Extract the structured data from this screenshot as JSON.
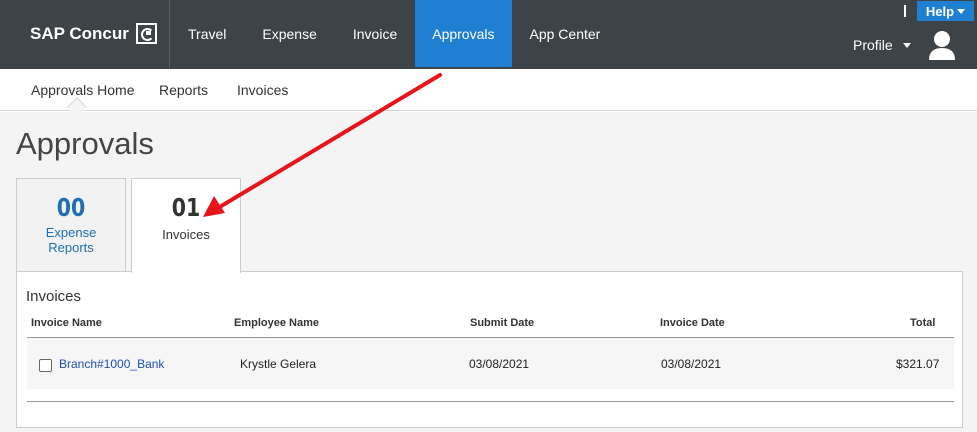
{
  "brand": {
    "name": "SAP Concur"
  },
  "nav": {
    "items": [
      {
        "label": "Travel"
      },
      {
        "label": "Expense"
      },
      {
        "label": "Invoice"
      },
      {
        "label": "Approvals"
      },
      {
        "label": "App Center"
      }
    ],
    "active_color": "#1f7fd1"
  },
  "header": {
    "help_label": "Help",
    "profile_label": "Profile"
  },
  "subnav": {
    "items": [
      {
        "label": "Approvals Home"
      },
      {
        "label": "Reports"
      },
      {
        "label": "Invoices"
      }
    ]
  },
  "page": {
    "title": "Approvals"
  },
  "tabs": [
    {
      "count": "00",
      "label_line1": "Expense",
      "label_line2": "Reports"
    },
    {
      "count": "01",
      "label": "Invoices"
    }
  ],
  "invoices": {
    "title": "Invoices",
    "columns": [
      "Invoice Name",
      "Employee Name",
      "Submit Date",
      "Invoice Date",
      "Total"
    ],
    "rows": [
      {
        "name": "Branch#1000_Bank",
        "employee": "Krystle Gelera",
        "submit_date": "03/08/2021",
        "invoice_date": "03/08/2021",
        "total": "$321.07"
      }
    ]
  },
  "annotation": {
    "arrow_color": "#e8141b"
  }
}
